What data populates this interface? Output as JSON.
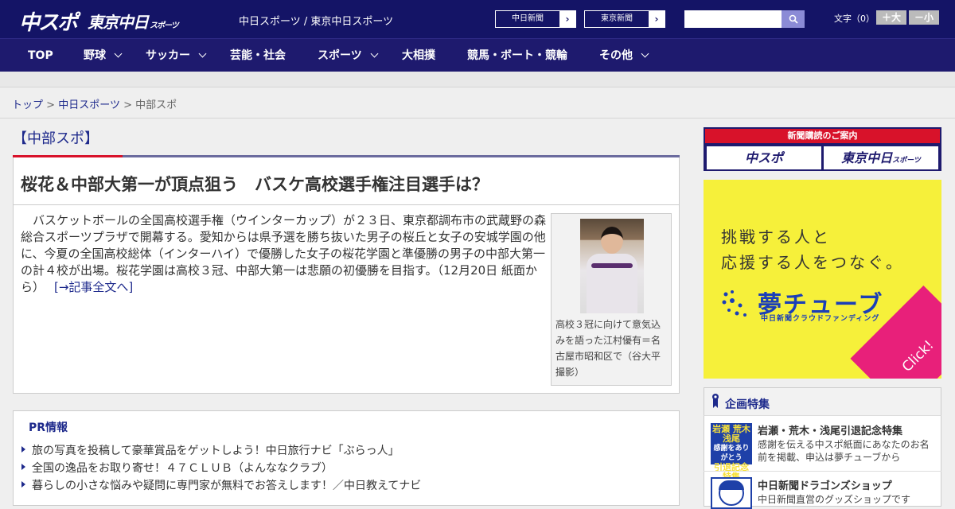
{
  "header": {
    "logo_chuspo": "中スポ",
    "logo_tokyo": "東京中日",
    "logo_tokyo_small": "スポーツ",
    "site_name": "中日スポーツ / 東京中日スポーツ",
    "btn_chunichi": "中日新聞",
    "btn_tokyo": "東京新聞",
    "search_placeholder": "",
    "font_label": "文字（0）",
    "font_bigger": "＋大",
    "font_smaller": "－小"
  },
  "nav": [
    {
      "label": "TOP",
      "dropdown": false
    },
    {
      "label": "野球",
      "dropdown": true
    },
    {
      "label": "サッカー",
      "dropdown": true
    },
    {
      "label": "芸能・社会",
      "dropdown": false
    },
    {
      "label": "スポーツ",
      "dropdown": true
    },
    {
      "label": "大相撲",
      "dropdown": false
    },
    {
      "label": "競馬・ボート・競輪",
      "dropdown": false
    },
    {
      "label": "その他",
      "dropdown": true
    }
  ],
  "breadcrumb": {
    "home": "トップ",
    "sep1": ">",
    "section": "中日スポーツ",
    "sep2": ">",
    "current": "中部スポ"
  },
  "article": {
    "section_title": "【中部スポ】",
    "headline": "桜花＆中部大第一が頂点狙う　バスケ高校選手権注目選手は？",
    "lead": "　バスケットボールの全国高校選手権（ウインターカップ）が２３日、東京都調布市の武蔵野の森総合スポーツプラザで開幕する。愛知からは県予選を勝ち抜いた男子の桜丘と女子の安城学園の他に、今夏の全国高校総体（インターハイ）で優勝した女子の桜花学園と準優勝の男子の中部大第一の計４校が出場。桜花学園は高校３冠、中部大第一は悲願の初優勝を目指す。（12月20日 紙面から）",
    "read_more": "[→記事全文へ]",
    "photo_caption": "高校３冠に向けて意気込みを語った江村優有＝名古屋市昭和区で（谷大平撮影）"
  },
  "pr": {
    "title": "PR情報",
    "items": [
      "旅の写真を投稿して豪華賞品をゲットしよう！中日旅行ナビ「ぶらっ人」",
      "全国の逸品をお取り寄せ！４７ＣＬＵＢ（よんななクラブ）",
      "暮らしの小さな悩みや疑問に専門家が無料でお答えします！／中日教えてナビ"
    ]
  },
  "sidebar": {
    "subscribe_title": "新聞購読のご案内",
    "subscribe_chuspo": "中スポ",
    "subscribe_tokyo": "東京中日",
    "subscribe_tokyo_small": "スポーツ",
    "ad_line1": "挑戦する人と",
    "ad_line2": "応援する人をつなぐ。",
    "ad_brand": "夢チューブ",
    "ad_sub": "中日新聞クラウドファンディング",
    "ad_click": "Click!",
    "feature_title": "企画特集",
    "features": [
      {
        "title": "岩瀬・荒木・浅尾引退記念特集",
        "desc": "感謝を伝える中スポ紙面にあなたのお名前を掲載、申込は夢チューブから",
        "thumb_top": "岩瀬 荒木 浅尾",
        "thumb_mid": "感謝をありがとう",
        "thumb_bot": "引退記念特集"
      },
      {
        "title": "中日新聞ドラゴンズショップ",
        "desc": "中日新聞直営のグッズショップです"
      }
    ]
  },
  "colors": {
    "header_bg": "#141466",
    "nav_bg": "#1e1a6e",
    "link": "#1e2a8c",
    "accent_red": "#d8122a",
    "ad_yellow": "#f6f03a",
    "ad_pink": "#e8207a"
  }
}
